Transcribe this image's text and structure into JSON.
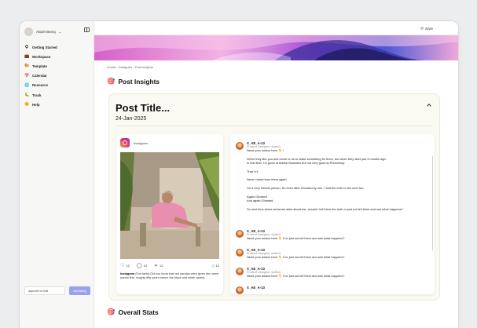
{
  "sidebar": {
    "user_name": "Akash Bearq",
    "items": [
      {
        "icon": "⛭",
        "label": "Getting Started"
      },
      {
        "icon": "💼",
        "label": "Workspace"
      },
      {
        "icon": "🎨",
        "label": "Template"
      },
      {
        "icon": "📅",
        "label": "Calendar"
      },
      {
        "icon": "🌐",
        "label": "Resource"
      },
      {
        "icon": "🐛",
        "label": "Track"
      },
      {
        "icon": "😊",
        "label": "Help"
      }
    ],
    "trial_text": "days left on trial",
    "trial_button": "Add billing"
  },
  "topbar": {
    "style_label": "Style"
  },
  "breadcrumb": "Social  ›  Instagram  ›  Post Insights",
  "section_post_insights": "Post Insights",
  "section_overall_stats": "Overall Stats",
  "post": {
    "title": "Post Title...",
    "date": "24-Jan-2025"
  },
  "instagram": {
    "label": "Instagram",
    "likes": "12",
    "comments": "13",
    "shares": "12",
    "saves": "13",
    "caption_user": "Instagram",
    "caption": "(Fun facts) Did you know that red pandas were given the name panda first, roughly fifty years before the black and white variety."
  },
  "comments": [
    {
      "name": "X_AE_A-13",
      "role": "Product Designer, slothUI",
      "lines": [
        "Need your advice here 👇 !",
        "",
        "When they like you and come to us to make something for them, but when they start just 3 months ago.",
        "In this field, I'm good at Adobe Illustrator but not very good at Photoshop.",
        "",
        "That 's it",
        "",
        "Never heard from them again",
        "",
        "I'm a very honest person. So even after Ghosted by one, I told the truth to the next two",
        "",
        "Again Ghosted",
        "And again Ghosted",
        "",
        "So next time when someone asks about me, should I tell them the truth or just not tell them and see what happens?"
      ]
    },
    {
      "name": "X_AE_A-13",
      "role": "Product Designer, slothUI",
      "lines": [
        "Need your advice here 👇 if or just not tell them and see what happens?"
      ]
    },
    {
      "name": "X_AE_A-13",
      "role": "Product Designer, slothUI",
      "lines": [
        "Need your advice here 👇 if or just not tell them and see what happens?"
      ]
    },
    {
      "name": "X_AE_A-13",
      "role": "Product Designer, slothUI",
      "lines": [
        "Need your advice here 👇 if or just not tell them and see what happens?"
      ]
    },
    {
      "name": "X_AE_A-13",
      "role": "",
      "lines": []
    }
  ]
}
